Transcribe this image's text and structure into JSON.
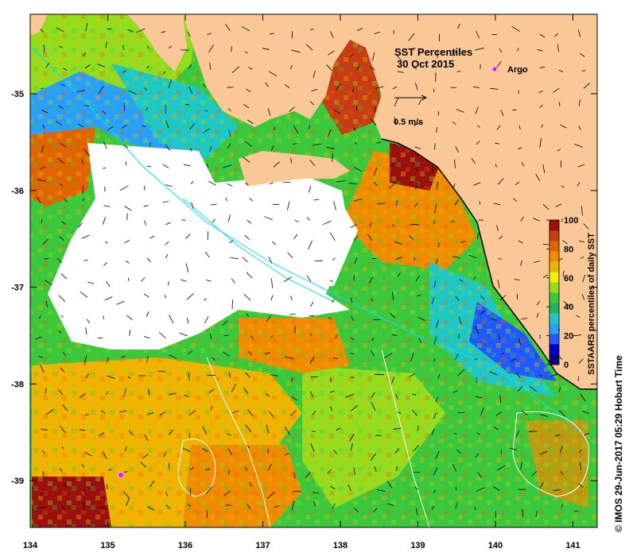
{
  "map": {
    "title": "SST Percentiles",
    "date": "30 Oct 2015",
    "legend_argo": "Argo",
    "scale_label": "0.5 m/s",
    "colorbar": {
      "label": "SSTAARS percentiles of daily  SST",
      "ticks": [
        "0",
        "20",
        "40",
        "60",
        "80",
        "100"
      ],
      "colors": [
        "#000080",
        "#0000c8",
        "#1e5aff",
        "#28a0ff",
        "#1ec8c8",
        "#1eb464",
        "#3cc83c",
        "#96dc1e",
        "#f0f000",
        "#f0b400",
        "#f08c00",
        "#e06400",
        "#c83c14",
        "#9b0f0f"
      ]
    },
    "credit": "©  IMOS 29-Jun-2017 05:29 Hobart Time",
    "lon_ticks": [
      "134",
      "135",
      "136",
      "137",
      "138",
      "139",
      "140",
      "141"
    ],
    "lat_ticks": [
      "-35",
      "-36",
      "-37",
      "-38",
      "-39"
    ],
    "land_color": "#fac896"
  }
}
